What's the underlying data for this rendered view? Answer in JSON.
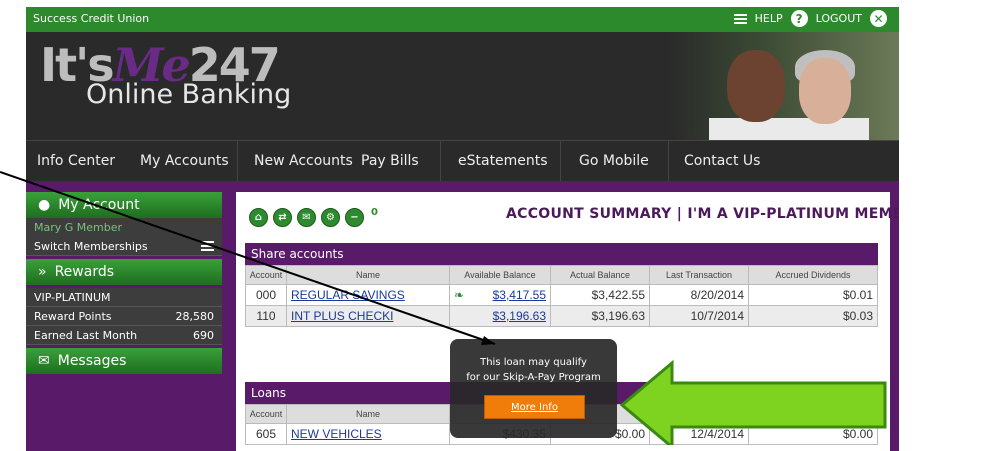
{
  "org_name": "Success Credit Union",
  "top_links": {
    "help": "HELP",
    "logout": "LOGOUT"
  },
  "logo": {
    "its": "It's",
    "me": "Me",
    "num": "247",
    "sub": "Online Banking"
  },
  "nav": [
    "Info Center",
    "My Accounts",
    "New Accounts",
    "Pay Bills",
    "eStatements",
    "Go Mobile",
    "Contact Us"
  ],
  "sidebar": {
    "my_account": "My Account",
    "member_name": "Mary G Member",
    "switch": "Switch Memberships",
    "rewards": "Rewards",
    "tier": "VIP-PLATINUM",
    "reward_points_label": "Reward Points",
    "reward_points": "28,580",
    "earned_label": "Earned Last Month",
    "earned": "690",
    "messages": "Messages"
  },
  "toolbar": {
    "badge": "0"
  },
  "summary_title": "ACCOUNT SUMMARY | I'M A VIP-PLATINUM MEMBER",
  "share": {
    "title": "Share accounts",
    "headers": [
      "Account",
      "Name",
      "Available Balance",
      "Actual Balance",
      "Last Transaction",
      "Accrued Dividends"
    ],
    "rows": [
      {
        "account": "000",
        "name": "REGULAR SAVINGS",
        "available": "$3,417.55",
        "actual": "$3,422.55",
        "last": "8/20/2014",
        "accrued": "$0.01"
      },
      {
        "account": "110",
        "name": "INT PLUS CHECKI",
        "available": "$3,196.63",
        "actual": "$3,196.63",
        "last": "10/7/2014",
        "accrued": "$0.03"
      }
    ]
  },
  "loans": {
    "title": "Loans",
    "headers": [
      "Account",
      "Name"
    ],
    "rows": [
      {
        "account": "605",
        "name": "NEW VEHICLES",
        "balance": "$430.35",
        "c4": "$0.00",
        "last": "12/4/2014",
        "c6": "$0.00"
      }
    ]
  },
  "tooltip": {
    "line1": "This loan may qualify",
    "line2": "for our Skip-A-Pay Program",
    "button": "More Info"
  },
  "colors": {
    "green": "#2c8a2c",
    "purple": "#5a1a6a",
    "orange": "#f07d0a",
    "arrow": "#7ed321"
  }
}
